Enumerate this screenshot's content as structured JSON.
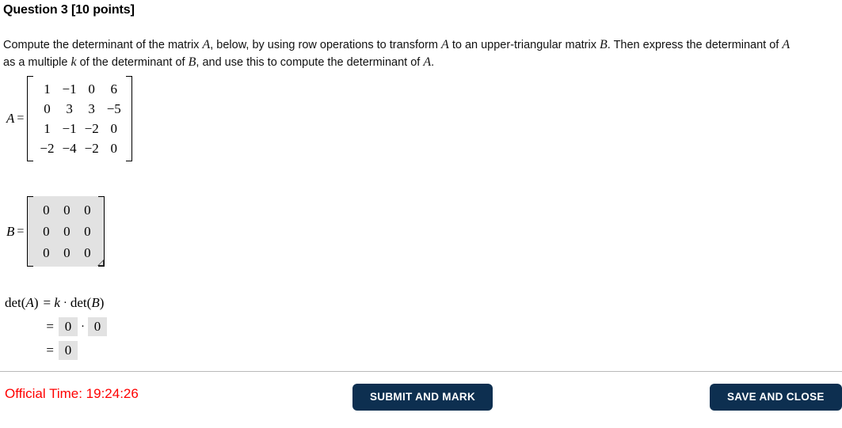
{
  "question": {
    "heading": "Question 3 [10 points]",
    "prompt_part1": "Compute the determinant of the matrix ",
    "var_A1": "A",
    "prompt_part2": ", below, by using row operations to transform ",
    "var_A2": "A",
    "prompt_part3": " to an upper-triangular matrix ",
    "var_B1": "B",
    "prompt_part4": ". Then express the determinant of ",
    "var_A3": "A",
    "prompt_part5": " as a multiple ",
    "var_k": "k",
    "prompt_part6": " of the determinant of ",
    "var_B2": "B",
    "prompt_part7": ", and use this to compute the determinant of ",
    "var_A4": "A",
    "prompt_part8": "."
  },
  "matrix_a": {
    "label": "A",
    "equals": "=",
    "rows": [
      [
        "1",
        "−1",
        "0",
        "6"
      ],
      [
        "0",
        "3",
        "3",
        "−5"
      ],
      [
        "1",
        "−1",
        "−2",
        "0"
      ],
      [
        "−2",
        "−4",
        "−2",
        "0"
      ]
    ]
  },
  "matrix_b": {
    "label": "B",
    "equals": "=",
    "rows": [
      [
        "0",
        "0",
        "0"
      ],
      [
        "0",
        "0",
        "0"
      ],
      [
        "0",
        "0",
        "0"
      ]
    ]
  },
  "determinant": {
    "line1": {
      "lead_det": "det(",
      "lead_var": "A",
      "lead_close": ")",
      "equals": "=",
      "k": "k",
      "dot": "·",
      "det": "det(",
      "var_b": "B",
      "close": ")"
    },
    "line2": {
      "equals": "=",
      "value_k": "0",
      "dot": "·",
      "value_detb": "0"
    },
    "line3": {
      "equals": "=",
      "value_deta": "0"
    }
  },
  "footer": {
    "official_time_label": "Official Time: 19:24:26",
    "submit_label": "SUBMIT AND MARK",
    "save_label": "SAVE AND CLOSE",
    "time_color": "#ff0000",
    "button_color": "#0d2f50"
  }
}
